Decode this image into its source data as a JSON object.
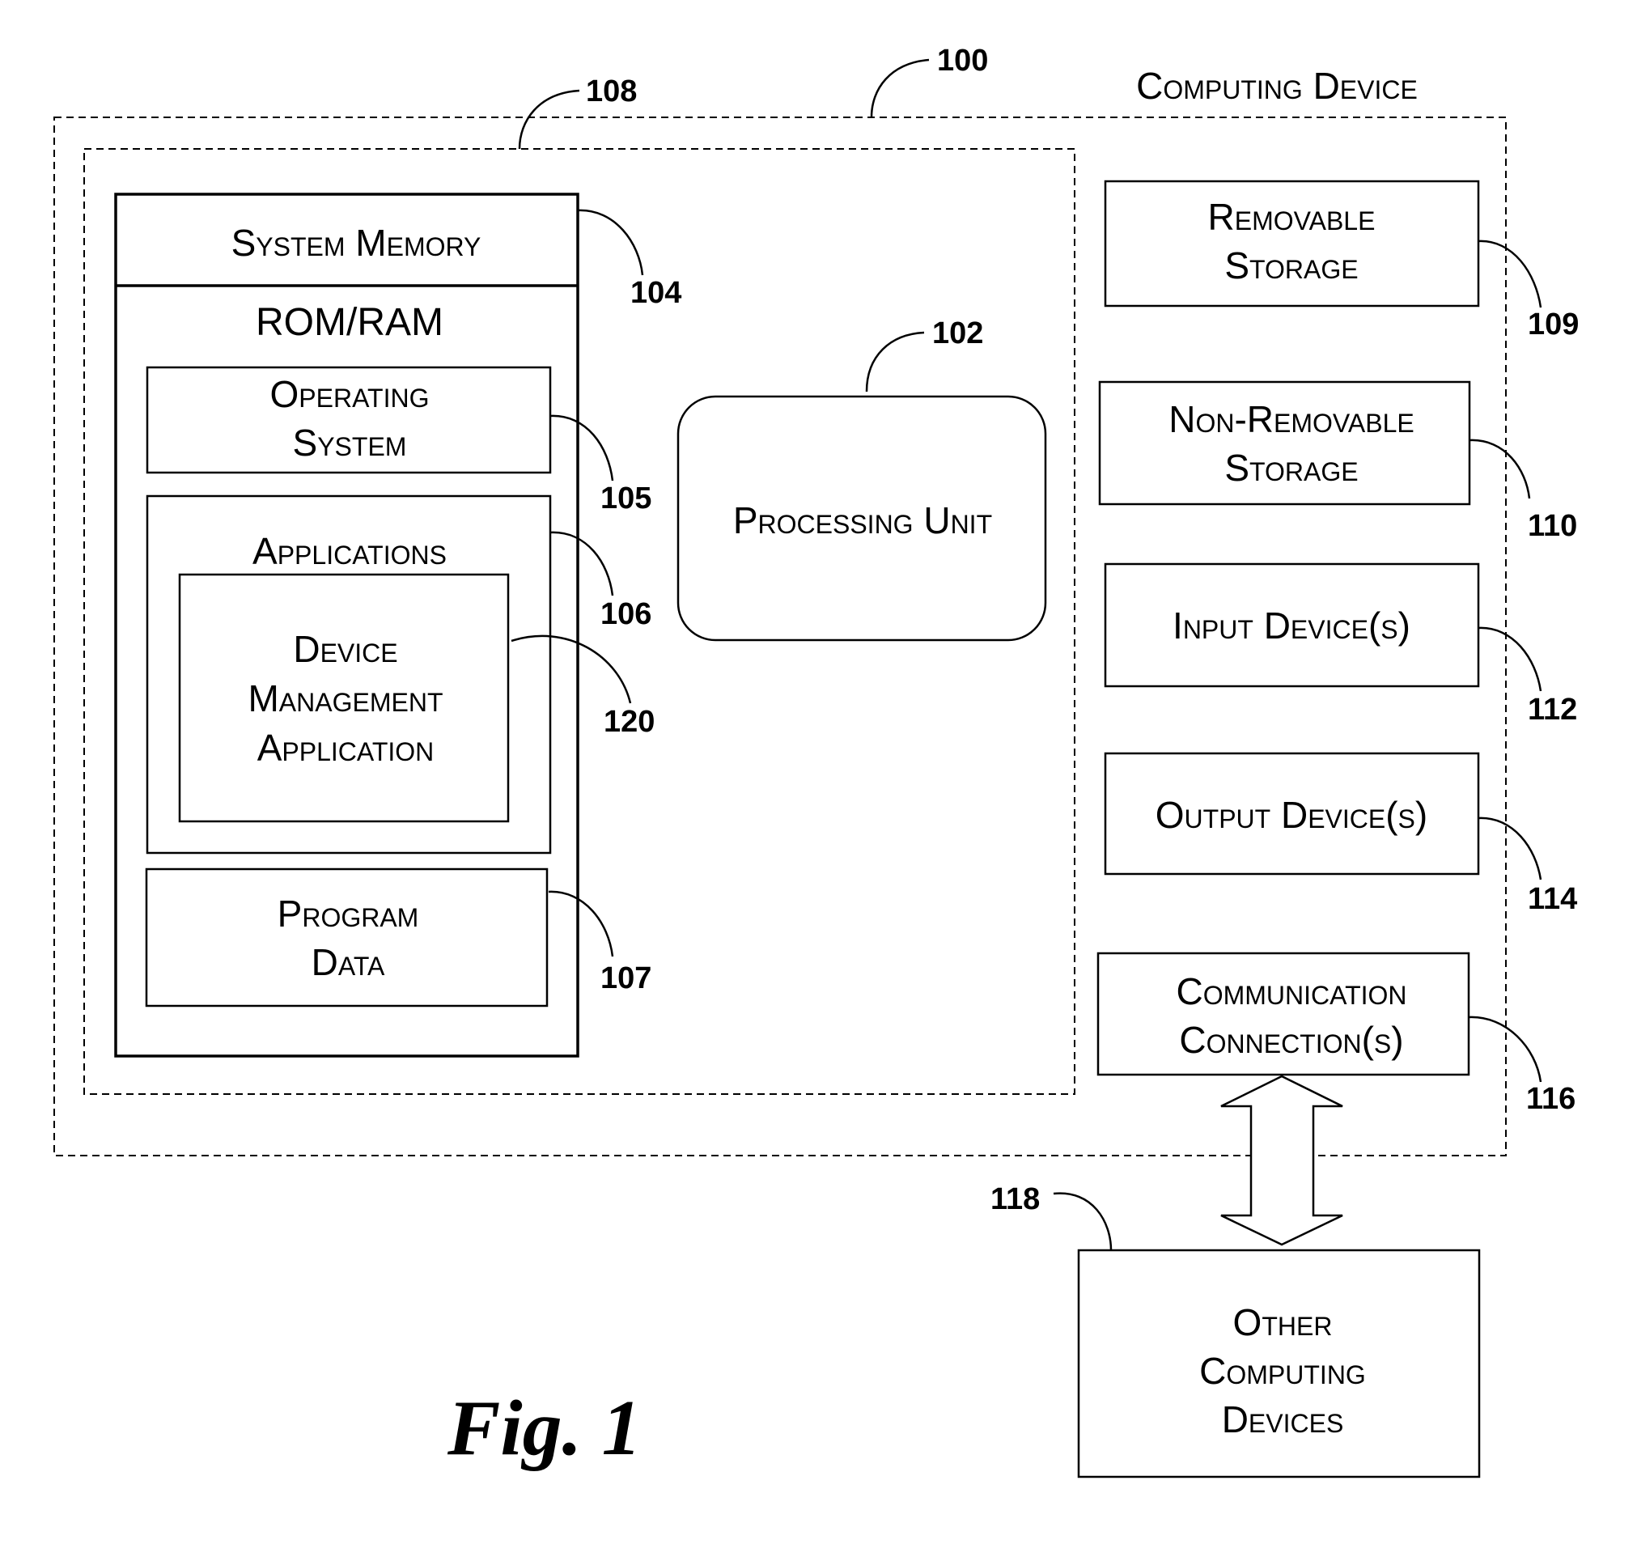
{
  "figure": {
    "caption": "Fig. 1",
    "title": "Computing Device"
  },
  "computing_device": {
    "label": "Computing Device",
    "ref": "100"
  },
  "basic_config": {
    "ref": "108"
  },
  "system_memory": {
    "title": "System Memory",
    "subtitle": "ROM/RAM",
    "ref": "104",
    "operating_system": {
      "lines": [
        "Operating",
        "System"
      ],
      "ref": "105"
    },
    "applications": {
      "label": "Applications",
      "ref": "106"
    },
    "device_management_application": {
      "lines": [
        "Device",
        "Management",
        "Application"
      ],
      "ref": "120"
    },
    "program_data": {
      "lines": [
        "Program",
        "Data"
      ],
      "ref": "107"
    }
  },
  "processing_unit": {
    "label": "Processing Unit",
    "ref": "102"
  },
  "peripherals": [
    {
      "id": "removable-storage",
      "lines": [
        "Removable",
        "Storage"
      ],
      "ref": "109"
    },
    {
      "id": "non-removable-storage",
      "lines": [
        "Non-Removable",
        "Storage"
      ],
      "ref": "110"
    },
    {
      "id": "input-devices",
      "lines": [
        "Input Device(s)"
      ],
      "ref": "112"
    },
    {
      "id": "output-devices",
      "lines": [
        "Output Device(s)"
      ],
      "ref": "114"
    },
    {
      "id": "communication-connections",
      "lines": [
        "Communication",
        "Connection(s)"
      ],
      "ref": "116"
    }
  ],
  "other_computing_devices": {
    "lines": [
      "Other",
      "Computing",
      "Devices"
    ],
    "ref": "118"
  }
}
